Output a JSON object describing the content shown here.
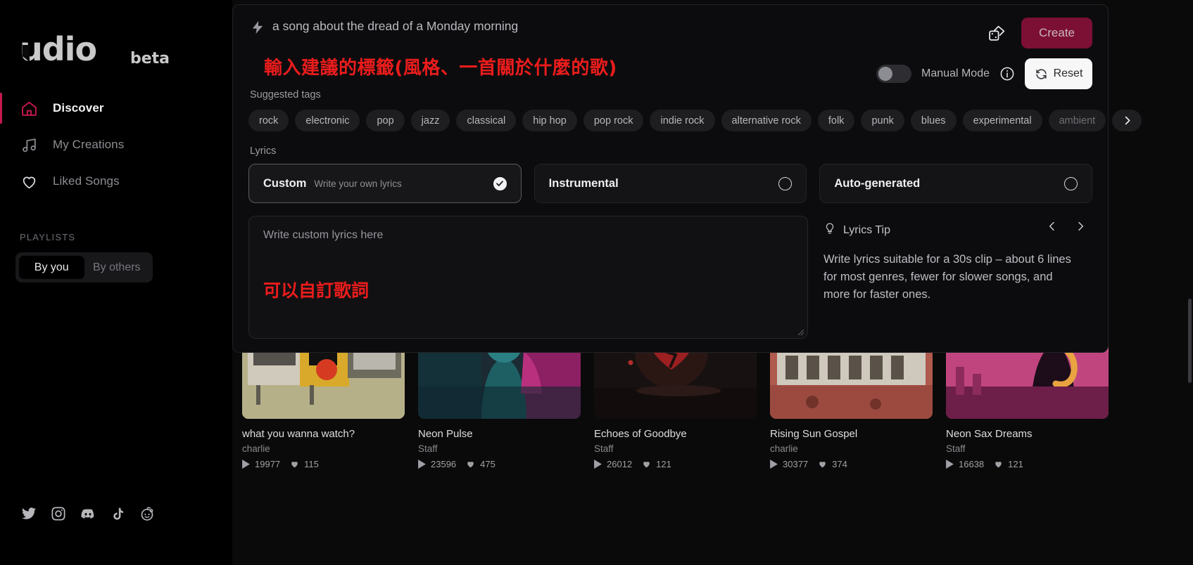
{
  "sidebar": {
    "logo": {
      "text": "udio",
      "beta": "beta"
    },
    "items": [
      {
        "label": "Discover",
        "icon": "home-icon",
        "active": true
      },
      {
        "label": "My Creations",
        "icon": "music-note-icon",
        "active": false
      },
      {
        "label": "Liked Songs",
        "icon": "heart-icon",
        "active": false
      }
    ],
    "playlists_label": "PLAYLISTS",
    "segments": [
      {
        "label": "By you",
        "selected": true
      },
      {
        "label": "By others",
        "selected": false
      }
    ],
    "socials": [
      "twitter-icon",
      "instagram-icon",
      "discord-icon",
      "tiktok-icon",
      "reddit-icon"
    ]
  },
  "panel": {
    "prompt_text": "a song about the dread of a Monday morning",
    "prompt_annotation_red": "輸入建議的標籤(風格、一首關於什麼的歌)",
    "dice_icon": "dice-icon",
    "create_label": "Create",
    "manual_mode_label": "Manual Mode",
    "manual_mode_on": false,
    "info_icon": "info-icon",
    "reset_label": "Reset",
    "reset_icon": "refresh-icon",
    "suggested_tags_label": "Suggested tags",
    "tags": [
      "rock",
      "electronic",
      "pop",
      "jazz",
      "classical",
      "hip hop",
      "pop rock",
      "indie rock",
      "alternative rock",
      "folk",
      "punk",
      "blues",
      "experimental",
      "ambient"
    ],
    "tags_next_icon": "chevron-right-icon",
    "lyrics_label": "Lyrics",
    "lyrics_options": [
      {
        "name": "Custom",
        "desc": "Write your own lyrics",
        "selected": true
      },
      {
        "name": "Instrumental",
        "desc": "",
        "selected": false
      },
      {
        "name": "Auto-generated",
        "desc": "",
        "selected": false
      }
    ],
    "lyrics_placeholder": "Write custom lyrics here",
    "lyrics_annotation_red": "可以自訂歌詞",
    "tip": {
      "icon": "lightbulb-icon",
      "title": "Lyrics Tip",
      "body": "Write lyrics suitable for a 30s clip – about 6 lines for most genres, fewer for slower songs, and more for faster ones.",
      "prev_icon": "chevron-left-icon",
      "next_icon": "chevron-right-icon"
    }
  },
  "grid": {
    "cards": [
      {
        "title": "what you wanna watch?",
        "author": "charlie",
        "plays": "19977",
        "likes": "115",
        "art": "collage-tv"
      },
      {
        "title": "Neon Pulse",
        "author": "Staff",
        "plays": "23596",
        "likes": "475",
        "art": "neon-figure"
      },
      {
        "title": "Echoes of Goodbye",
        "author": "Staff",
        "plays": "26012",
        "likes": "121",
        "art": "broken-heart"
      },
      {
        "title": "Rising Sun Gospel",
        "author": "charlie",
        "plays": "30377",
        "likes": "374",
        "art": "old-building"
      },
      {
        "title": "Neon Sax Dreams",
        "author": "Staff",
        "plays": "16638",
        "likes": "121",
        "art": "sax-player"
      }
    ],
    "play_icon": "play-icon",
    "like_icon": "heart-filled-icon"
  },
  "colors": {
    "accent": "#c3194c",
    "create_bg": "#7c0f34",
    "annotation_red": "#ec1c1c",
    "panel_bg": "#0c0c0e"
  }
}
